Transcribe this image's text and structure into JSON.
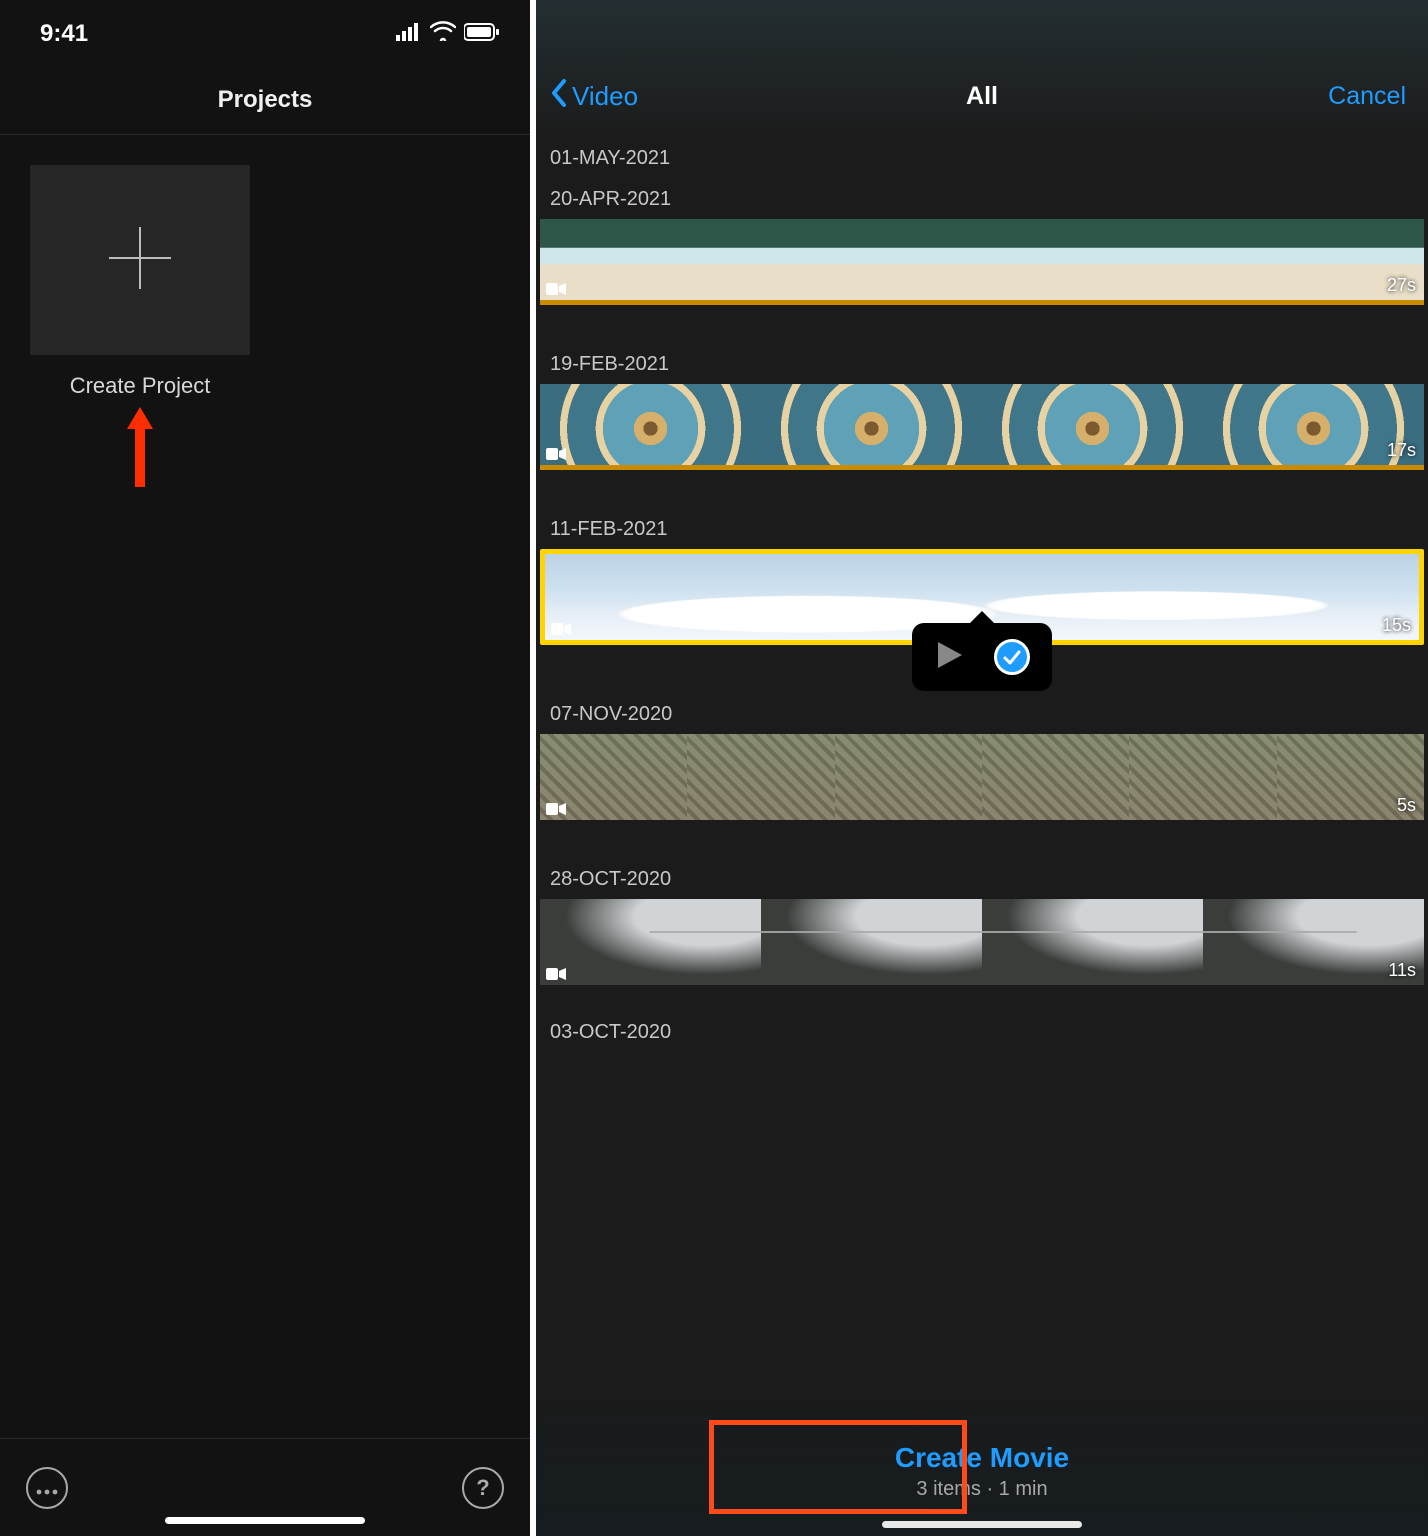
{
  "left": {
    "time": "9:41",
    "title": "Projects",
    "create_label": "Create Project",
    "more_icon": "more-icon",
    "help_icon": "help-icon"
  },
  "right": {
    "back_label": "Video",
    "title": "All",
    "cancel": "Cancel",
    "footer": {
      "create": "Create Movie",
      "sub": "3 items · 1 min"
    },
    "sections": [
      {
        "label": "01-MAY-2021"
      },
      {
        "label": "20-APR-2021",
        "duration": "27s",
        "kind": "beach",
        "marked": true
      },
      {
        "label": "19-FEB-2021",
        "duration": "17s",
        "kind": "vinyl",
        "marked": true
      },
      {
        "label": "11-FEB-2021",
        "duration": "15s",
        "kind": "clouds",
        "selected": true
      },
      {
        "label": "07-NOV-2020",
        "duration": "5s",
        "kind": "city"
      },
      {
        "label": "28-OCT-2020",
        "duration": "11s",
        "kind": "road"
      },
      {
        "label": "03-OCT-2020"
      }
    ]
  },
  "colors": {
    "accent": "#1f9cff",
    "highlight": "#ff4a1a",
    "select": "#ffd400"
  }
}
